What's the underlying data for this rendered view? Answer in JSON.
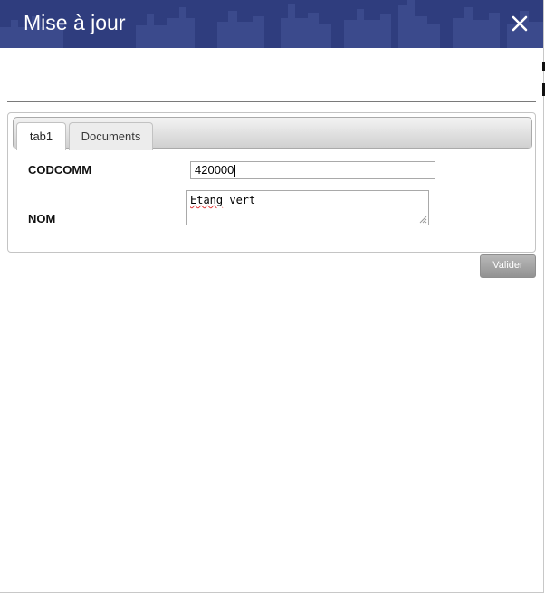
{
  "window": {
    "title": "Mise à jour",
    "close_icon": "close-icon",
    "title_bar_color": "#2f3d7e"
  },
  "tabs": [
    {
      "label": "tab1",
      "active": true
    },
    {
      "label": "Documents",
      "active": false
    }
  ],
  "form": {
    "codcomm": {
      "label": "CODCOMM",
      "value": "420000"
    },
    "nom": {
      "label": "NOM",
      "value_word1": "Etang",
      "value_word2": " vert"
    }
  },
  "actions": {
    "valider_label": "Valider",
    "button_color": "#a0a0a0"
  }
}
